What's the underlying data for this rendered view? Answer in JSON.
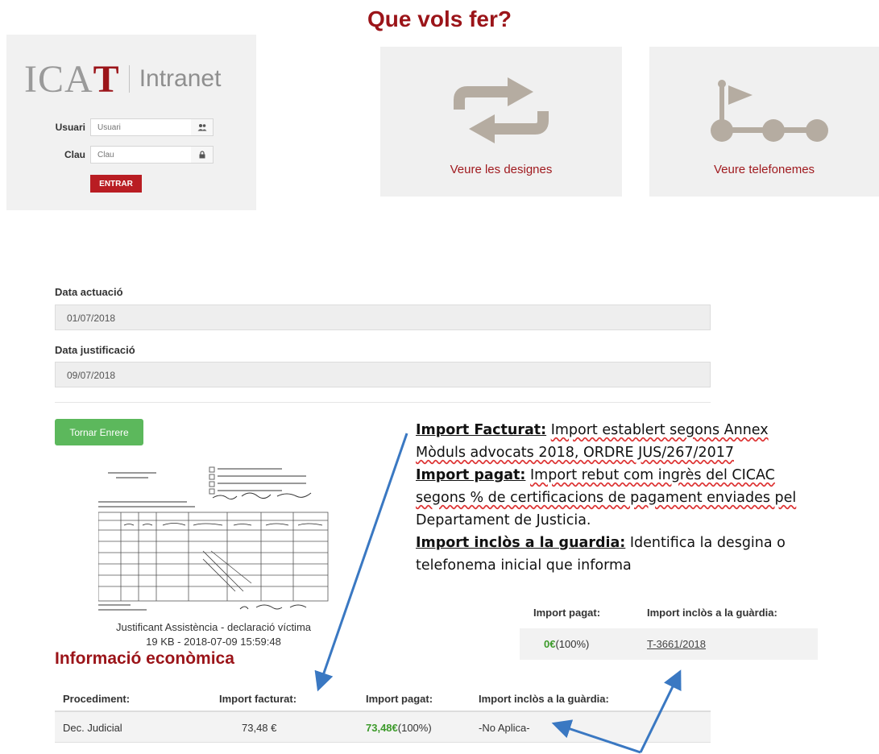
{
  "header": {
    "title": "Que vols fer?"
  },
  "login": {
    "logo_ica": "ICA",
    "logo_t": "T",
    "logo_intranet": "Intranet",
    "user_label": "Usuari",
    "user_placeholder": "Usuari",
    "user_icon": "users-icon",
    "pass_label": "Clau",
    "pass_placeholder": "Clau",
    "pass_icon": "lock-icon",
    "submit_label": "ENTRAR"
  },
  "actions": [
    {
      "label": "Veure les designes",
      "icon": "swap-arrows-icon"
    },
    {
      "label": "Veure telefonemes",
      "icon": "flag-route-icon"
    }
  ],
  "form": {
    "data_actuacio_label": "Data actuació",
    "data_actuacio_value": "01/07/2018",
    "data_justificacio_label": "Data justificació",
    "data_justificacio_value": "09/07/2018",
    "back_button": "Tornar Enrere"
  },
  "attachment": {
    "caption": "Justificant Assistència - declaració víctima",
    "meta": "19 KB - 2018-07-09 15:59:48"
  },
  "annotation": {
    "p1_label": "Import Facturat:",
    "p1_text_a": "Import establert segons Annex",
    "p1_text_b": "Mòduls advocats 2018, ORDRE JUS/267/2017",
    "p2_label": "Import pagat:",
    "p2_text_a": "Import rebut com ingrès del CICAC",
    "p2_text_b": "segons % de certificacions de pagament enviades pel",
    "p2_text_c": "Departament de Justicia.",
    "p3_label": "Import inclòs a la guardia:",
    "p3_text_a": "Identifica la desgina o",
    "p3_text_b": "telefonema inicial que informa"
  },
  "guard_table": {
    "headers": [
      "Import pagat:",
      "Import inclòs a la guàrdia:"
    ],
    "row": {
      "amount": "0€",
      "pct": "(100%)",
      "link": "T-3661/2018"
    }
  },
  "economic": {
    "title": "Informació econòmica",
    "headers": [
      "Procediment:",
      "Import facturat:",
      "Import pagat:",
      "Import inclòs a la guàrdia:"
    ],
    "row": {
      "procediment": "Dec. Judicial",
      "facturat": "73,48 €",
      "pagat_amount": "73,48€",
      "pagat_pct": "(100%)",
      "inclos": "-No Aplica-"
    }
  },
  "colors": {
    "brand_red": "#9b1419",
    "button_green": "#5cb85c",
    "annotation_arrow": "#3a78c2"
  }
}
